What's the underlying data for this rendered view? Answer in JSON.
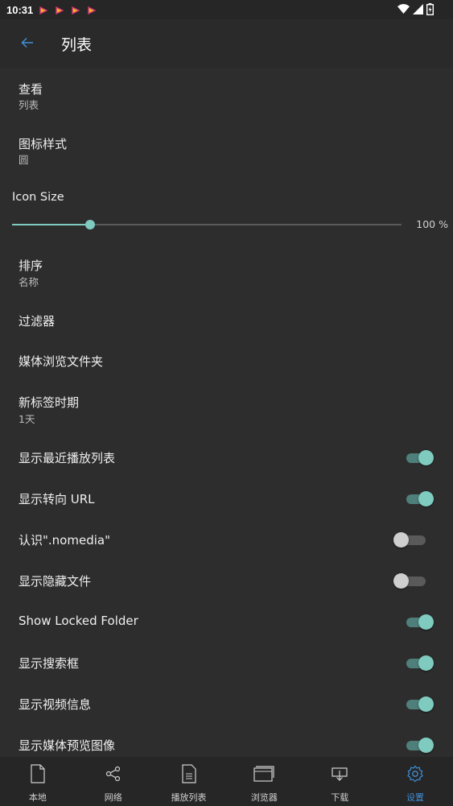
{
  "status": {
    "time": "10:31"
  },
  "appbar": {
    "title": "列表"
  },
  "settings": {
    "view": {
      "label": "查看",
      "value": "列表"
    },
    "icon_style": {
      "label": "图标样式",
      "value": "圆"
    },
    "icon_size": {
      "label": "Icon Size",
      "value_text": "100 %",
      "fraction": 0.2
    },
    "sort": {
      "label": "排序",
      "value": "名称"
    },
    "filter": {
      "label": "过滤器"
    },
    "media_folder": {
      "label": "媒体浏览文件夹"
    },
    "new_tab_period": {
      "label": "新标签时期",
      "value": "1天"
    },
    "toggles": [
      {
        "label": "显示最近播放列表",
        "on": true
      },
      {
        "label": "显示转向 URL",
        "on": true
      },
      {
        "label": "认识\".nomedia\"",
        "on": false
      },
      {
        "label": "显示隐藏文件",
        "on": false
      },
      {
        "label": "Show Locked Folder",
        "on": true
      },
      {
        "label": "显示搜索框",
        "on": true
      },
      {
        "label": "显示视频信息",
        "on": true
      },
      {
        "label": "显示媒体预览图像",
        "on": true
      }
    ]
  },
  "nav": {
    "items": [
      {
        "label": "本地",
        "icon": "file-icon"
      },
      {
        "label": "网络",
        "icon": "share-icon"
      },
      {
        "label": "播放列表",
        "icon": "playlist-icon"
      },
      {
        "label": "浏览器",
        "icon": "browser-icon"
      },
      {
        "label": "下载",
        "icon": "download-icon"
      },
      {
        "label": "设置",
        "icon": "gear-icon",
        "active": true
      }
    ]
  },
  "colors": {
    "accent": "#7fcbc0",
    "active_nav": "#3f8fd6",
    "background": "#2d2d2d"
  }
}
